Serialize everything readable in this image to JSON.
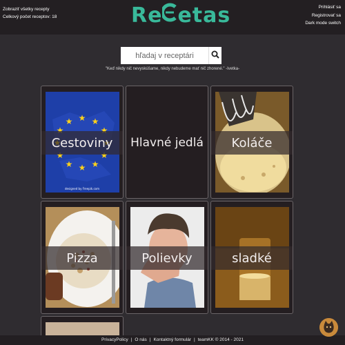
{
  "header": {
    "show_all_recipes": "Zobraziť všetky recepty",
    "total_recipes": "Celkový počet receptov: 18",
    "logo_text_pre": "Re",
    "logo_text_post": "etas",
    "login": "Prihlásiť sa",
    "register": "Registrovať sa",
    "dark_mode": "Dark mode switch"
  },
  "search": {
    "placeholder": "hľadaj v receptári",
    "button_icon": "search-icon"
  },
  "quote": "\"Keď nikdy nič nevyskúšame, nikdy nebudeme mať nič zhorené.\" -Ivetka-",
  "categories": [
    {
      "label": "Cestoviny",
      "image": "eu-flag"
    },
    {
      "label": "Hlavné jedlá",
      "image": "none"
    },
    {
      "label": "Koláče",
      "image": "mixer-bowl"
    },
    {
      "label": "Pizza",
      "image": "risotto-plate"
    },
    {
      "label": "Polievky",
      "image": "tired-man"
    },
    {
      "label": "sladké",
      "image": "glass-drink"
    }
  ],
  "eu_image_caption": "designed by Freepik.com",
  "footer": {
    "privacy": "PrivacyPolicy",
    "about": "O nás",
    "contact": "Kontaktný formulár",
    "copyright": "teamKK © 2014 - 2021"
  },
  "colors": {
    "brand": "#39b99a",
    "background": "#2f2c30",
    "topbar": "#231f22"
  }
}
